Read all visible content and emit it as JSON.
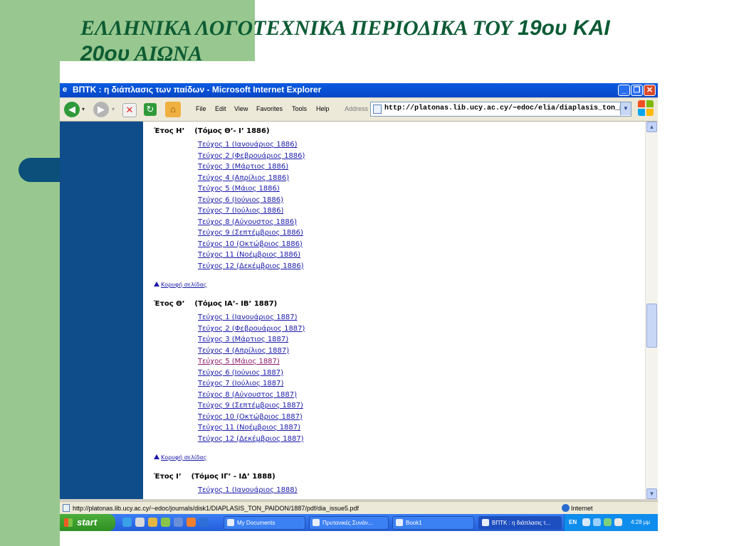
{
  "slide": {
    "title_part1": "ΕΛΛΗΝΙΚΑ ΛΟΓΟΤΕΧΝΙΚΑ ΠΕΡΙΟΔΙΚΑ ΤΟΥ ",
    "title_num1": "19ου ΚΑΙ",
    "title_num2": "20ου",
    "title_part2": " ΑΙΩΝΑ"
  },
  "browser": {
    "window_title": "ΒΠΤΚ : η διάπλασις των παίδων - Microsoft Internet Explorer",
    "menu": [
      "File",
      "Edit",
      "View",
      "Favorites",
      "Tools",
      "Help"
    ],
    "address_label": "Address",
    "address_value": "http://platonas.lib.ucy.ac.cy/~edoc/elia/diaplasis_ton_paidon/"
  },
  "content": {
    "sections": [
      {
        "year_label": "Έτος Η’",
        "volume_label": "(Τόμος Θ’- Ι’ 1886)",
        "issues": [
          "Τεύχος 1 (Ιανουάριος 1886)",
          "Τεύχος 2 (Φεβρουάριος 1886)",
          "Τεύχος 3 (Μάρτιος 1886)",
          "Τεύχος 4 (Απρίλιος 1886)",
          "Τεύχος 5 (Μάιος 1886)",
          "Τεύχος 6 (Ιούνιος 1886)",
          "Τεύχος 7 (Ιούλιος 1886)",
          "Τεύχος 8 (Αύγουστος 1886)",
          "Τεύχος 9 (Σεπτέμβριος 1886)",
          "Τεύχος 10 (Οκτώβριος 1886)",
          "Τεύχος 11 (Νοέμβριος 1886)",
          "Τεύχος 12 (Δεκέμβριος 1886)"
        ],
        "top_link": "Κορυφή σελίδας"
      },
      {
        "year_label": "Έτος Θ’",
        "volume_label": "(Τόμος ΙΑ’- ΙΒ’ 1887)",
        "issues": [
          "Τεύχος 1 (Ιανουάριος 1887)",
          "Τεύχος 2 (Φεβρουάριος 1887)",
          "Τεύχος 3 (Μάρτιος 1887)",
          "Τεύχος 4 (Απρίλιος 1887)",
          "Τεύχος 5 (Μάιος 1887)",
          "Τεύχος 6 (Ιούνιος 1887)",
          "Τεύχος 7 (Ιούλιος 1887)",
          "Τεύχος 8 (Αύγουστος 1887)",
          "Τεύχος 9 (Σεπτέμβριος 1887)",
          "Τεύχος 10 (Οκτώβριος 1887)",
          "Τεύχος 11 (Νοέμβριος 1887)",
          "Τεύχος 12 (Δεκέμβριος 1887)"
        ],
        "top_link": "Κορυφή σελίδας"
      },
      {
        "year_label": "Έτος Ι’",
        "volume_label": "(Τόμος ΙΓ’ - ΙΔ’ 1888)",
        "issues": [
          "Τεύχος 1 (Ιανουάριος 1888)"
        ]
      }
    ],
    "scroll_fraction": 0.55
  },
  "status_bar": {
    "text": "http://platonas.lib.ucy.ac.cy/~edoc/journals/disk1/DIAPLASIS_TON_PAIDON/1887/pdf/dia_issue5.pdf",
    "zone": "Internet"
  },
  "taskbar": {
    "start_label": "start",
    "tasks": [
      "My Documents",
      "Πρυτανικές Συνάν...",
      "Book1",
      "ΒΠΤΚ : η διάπλασις τ..."
    ],
    "language": "EN",
    "clock": "4:28 μμ"
  }
}
